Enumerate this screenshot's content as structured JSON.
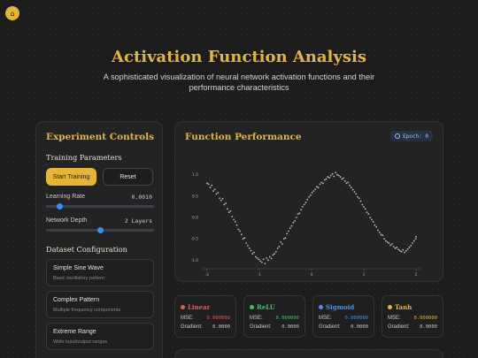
{
  "header": {
    "home_icon": "home-icon",
    "title": "Activation Function Analysis",
    "subtitle": "A sophisticated visualization of neural network activation functions and their performance characteristics"
  },
  "controls": {
    "title": "Experiment Controls",
    "training_title": "Training Parameters",
    "start_label": "Start Training",
    "reset_label": "Reset",
    "learning_rate_label": "Learning Rate",
    "learning_rate_value": "0.0010",
    "learning_rate_level": 0.1,
    "network_depth_label": "Network Depth",
    "network_depth_value": "2 Layers",
    "network_depth_level": 0.5,
    "dataset_title": "Dataset Configuration",
    "datasets": [
      {
        "name": "Simple Sine Wave",
        "desc": "Basic oscillatory pattern"
      },
      {
        "name": "Complex Pattern",
        "desc": "Multiple frequency components"
      },
      {
        "name": "Extreme Range",
        "desc": "Wide input/output ranges"
      }
    ]
  },
  "performance": {
    "title": "Function Performance",
    "epoch_label": "Epoch: 0",
    "epoch_icon": "clock-icon"
  },
  "metrics": [
    {
      "name": "Linear",
      "color": "#e05a5a",
      "mse_label": "MSE:",
      "mse": "0.000000",
      "mse_color": "#e05a5a",
      "grad_label": "Gradient:",
      "grad": "0.0000"
    },
    {
      "name": "ReLU",
      "color": "#3cc06a",
      "mse_label": "MSE:",
      "mse": "0.000000",
      "mse_color": "#3cc06a",
      "grad_label": "Gradient:",
      "grad": "0.0000"
    },
    {
      "name": "Sigmoid",
      "color": "#4a8ef0",
      "mse_label": "MSE:",
      "mse": "0.000000",
      "mse_color": "#4a8ef0",
      "grad_label": "Gradient:",
      "grad": "0.0000"
    },
    {
      "name": "Tanh",
      "color": "#e5b534",
      "mse_label": "MSE:",
      "mse": "0.000000",
      "mse_color": "#e5b534",
      "grad_label": "Gradient:",
      "grad": "0.0000"
    }
  ],
  "chart_data": {
    "type": "scatter",
    "x_ticks": [
      "-2",
      "-1",
      "0",
      "1",
      "2"
    ],
    "y_ticks": [
      "1.0",
      "0.5",
      "0.0",
      "-0.5",
      "-1.0"
    ],
    "xlim": [
      -2.1,
      2.1
    ],
    "ylim": [
      -1.2,
      1.2
    ],
    "grid": false,
    "points": [
      [
        -2.0,
        0.8
      ],
      [
        -1.97,
        0.78
      ],
      [
        -1.94,
        0.7
      ],
      [
        -1.91,
        0.75
      ],
      [
        -1.88,
        0.62
      ],
      [
        -1.85,
        0.66
      ],
      [
        -1.82,
        0.55
      ],
      [
        -1.79,
        0.58
      ],
      [
        -1.76,
        0.45
      ],
      [
        -1.73,
        0.4
      ],
      [
        -1.7,
        0.44
      ],
      [
        -1.67,
        0.3
      ],
      [
        -1.64,
        0.33
      ],
      [
        -1.61,
        0.2
      ],
      [
        -1.58,
        0.12
      ],
      [
        -1.55,
        0.15
      ],
      [
        -1.52,
        0.02
      ],
      [
        -1.49,
        -0.05
      ],
      [
        -1.46,
        -0.1
      ],
      [
        -1.43,
        -0.18
      ],
      [
        -1.4,
        -0.28
      ],
      [
        -1.37,
        -0.32
      ],
      [
        -1.34,
        -0.4
      ],
      [
        -1.31,
        -0.5
      ],
      [
        -1.28,
        -0.48
      ],
      [
        -1.25,
        -0.6
      ],
      [
        -1.22,
        -0.66
      ],
      [
        -1.19,
        -0.72
      ],
      [
        -1.16,
        -0.78
      ],
      [
        -1.13,
        -0.85
      ],
      [
        -1.1,
        -0.82
      ],
      [
        -1.07,
        -0.92
      ],
      [
        -1.04,
        -0.95
      ],
      [
        -1.01,
        -0.98
      ],
      [
        -0.98,
        -1.02
      ],
      [
        -0.95,
        -1.05
      ],
      [
        -0.92,
        -0.98
      ],
      [
        -0.89,
        -1.08
      ],
      [
        -0.86,
        -0.95
      ],
      [
        -0.83,
        -1.0
      ],
      [
        -0.8,
        -0.92
      ],
      [
        -0.77,
        -0.96
      ],
      [
        -0.74,
        -0.88
      ],
      [
        -0.71,
        -0.85
      ],
      [
        -0.68,
        -0.8
      ],
      [
        -0.65,
        -0.72
      ],
      [
        -0.62,
        -0.68
      ],
      [
        -0.59,
        -0.58
      ],
      [
        -0.56,
        -0.62
      ],
      [
        -0.53,
        -0.5
      ],
      [
        -0.5,
        -0.48
      ],
      [
        -0.47,
        -0.38
      ],
      [
        -0.44,
        -0.32
      ],
      [
        -0.41,
        -0.25
      ],
      [
        -0.38,
        -0.2
      ],
      [
        -0.35,
        -0.12
      ],
      [
        -0.32,
        -0.08
      ],
      [
        -0.29,
        0.0
      ],
      [
        -0.26,
        0.08
      ],
      [
        -0.23,
        0.1
      ],
      [
        -0.2,
        0.18
      ],
      [
        -0.17,
        0.25
      ],
      [
        -0.14,
        0.3
      ],
      [
        -0.11,
        0.35
      ],
      [
        -0.08,
        0.42
      ],
      [
        -0.05,
        0.48
      ],
      [
        -0.02,
        0.52
      ],
      [
        0.01,
        0.58
      ],
      [
        0.04,
        0.62
      ],
      [
        0.07,
        0.66
      ],
      [
        0.1,
        0.72
      ],
      [
        0.13,
        0.7
      ],
      [
        0.16,
        0.78
      ],
      [
        0.19,
        0.82
      ],
      [
        0.22,
        0.8
      ],
      [
        0.25,
        0.88
      ],
      [
        0.28,
        0.9
      ],
      [
        0.31,
        0.95
      ],
      [
        0.34,
        0.93
      ],
      [
        0.37,
        0.98
      ],
      [
        0.4,
        1.02
      ],
      [
        0.43,
        0.96
      ],
      [
        0.46,
        1.05
      ],
      [
        0.49,
        1.0
      ],
      [
        0.52,
        0.98
      ],
      [
        0.55,
        0.95
      ],
      [
        0.58,
        0.9
      ],
      [
        0.61,
        0.92
      ],
      [
        0.64,
        0.85
      ],
      [
        0.67,
        0.8
      ],
      [
        0.7,
        0.82
      ],
      [
        0.73,
        0.75
      ],
      [
        0.76,
        0.7
      ],
      [
        0.79,
        0.65
      ],
      [
        0.82,
        0.6
      ],
      [
        0.85,
        0.55
      ],
      [
        0.88,
        0.48
      ],
      [
        0.91,
        0.45
      ],
      [
        0.94,
        0.38
      ],
      [
        0.97,
        0.3
      ],
      [
        1.0,
        0.25
      ],
      [
        1.03,
        0.2
      ],
      [
        1.06,
        0.12
      ],
      [
        1.09,
        0.08
      ],
      [
        1.12,
        0.0
      ],
      [
        1.15,
        -0.05
      ],
      [
        1.18,
        -0.1
      ],
      [
        1.21,
        -0.18
      ],
      [
        1.24,
        -0.22
      ],
      [
        1.27,
        -0.3
      ],
      [
        1.3,
        -0.35
      ],
      [
        1.33,
        -0.4
      ],
      [
        1.36,
        -0.42
      ],
      [
        1.39,
        -0.5
      ],
      [
        1.42,
        -0.55
      ],
      [
        1.45,
        -0.58
      ],
      [
        1.48,
        -0.6
      ],
      [
        1.51,
        -0.65
      ],
      [
        1.54,
        -0.62
      ],
      [
        1.57,
        -0.68
      ],
      [
        1.6,
        -0.72
      ],
      [
        1.63,
        -0.7
      ],
      [
        1.66,
        -0.75
      ],
      [
        1.69,
        -0.78
      ],
      [
        1.72,
        -0.8
      ],
      [
        1.75,
        -0.76
      ],
      [
        1.78,
        -0.82
      ],
      [
        1.81,
        -0.78
      ],
      [
        1.84,
        -0.74
      ],
      [
        1.87,
        -0.7
      ],
      [
        1.9,
        -0.66
      ],
      [
        1.93,
        -0.6
      ],
      [
        1.96,
        -0.55
      ],
      [
        1.99,
        -0.5
      ],
      [
        2.0,
        -0.45
      ]
    ]
  }
}
